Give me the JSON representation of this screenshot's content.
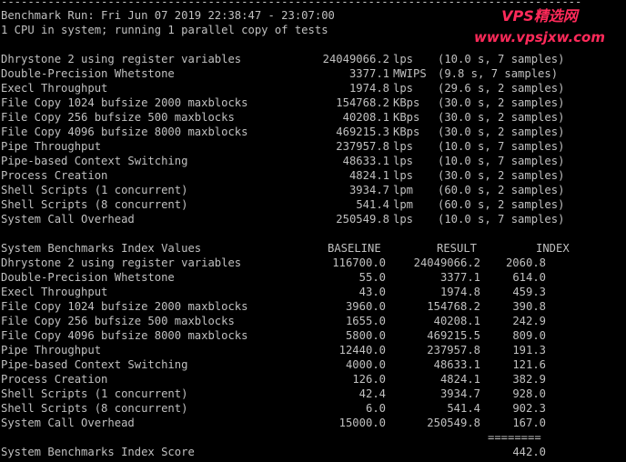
{
  "theme": {
    "background": "#000000",
    "text": "#c0c0c0",
    "watermark": "#ff2a5a"
  },
  "divider": "---------------------------------------------------------------------------------------",
  "header": {
    "run_line": "Benchmark Run: Fri Jun 07 2019 22:38:47 - 23:07:00",
    "cpu_line": "1 CPU in system; running 1 parallel copy of tests"
  },
  "watermark": {
    "title": "VPS精选网",
    "url": "www.vpsjxw.com"
  },
  "results": [
    {
      "name": "Dhrystone 2 using register variables",
      "value": "24049066.2",
      "unit": "lps",
      "detail": "(10.0 s, 7 samples)"
    },
    {
      "name": "Double-Precision Whetstone",
      "value": "3377.1",
      "unit": "MWIPS",
      "detail": "(9.8 s, 7 samples)"
    },
    {
      "name": "Execl Throughput",
      "value": "1974.8",
      "unit": "lps",
      "detail": "(29.6 s, 2 samples)"
    },
    {
      "name": "File Copy 1024 bufsize 2000 maxblocks",
      "value": "154768.2",
      "unit": "KBps",
      "detail": "(30.0 s, 2 samples)"
    },
    {
      "name": "File Copy 256 bufsize 500 maxblocks",
      "value": "40208.1",
      "unit": "KBps",
      "detail": "(30.0 s, 2 samples)"
    },
    {
      "name": "File Copy 4096 bufsize 8000 maxblocks",
      "value": "469215.3",
      "unit": "KBps",
      "detail": "(30.0 s, 2 samples)"
    },
    {
      "name": "Pipe Throughput",
      "value": "237957.8",
      "unit": "lps",
      "detail": "(10.0 s, 7 samples)"
    },
    {
      "name": "Pipe-based Context Switching",
      "value": "48633.1",
      "unit": "lps",
      "detail": "(10.0 s, 7 samples)"
    },
    {
      "name": "Process Creation",
      "value": "4824.1",
      "unit": "lps",
      "detail": "(30.0 s, 2 samples)"
    },
    {
      "name": "Shell Scripts (1 concurrent)",
      "value": "3934.7",
      "unit": "lpm",
      "detail": "(60.0 s, 2 samples)"
    },
    {
      "name": "Shell Scripts (8 concurrent)",
      "value": "541.4",
      "unit": "lpm",
      "detail": "(60.0 s, 2 samples)"
    },
    {
      "name": "System Call Overhead",
      "value": "250549.8",
      "unit": "lps",
      "detail": "(10.0 s, 7 samples)"
    }
  ],
  "index_table": {
    "title": "System Benchmarks Index Values",
    "headers": {
      "baseline": "BASELINE",
      "result": "RESULT",
      "index": "INDEX"
    },
    "rows": [
      {
        "name": "Dhrystone 2 using register variables",
        "baseline": "116700.0",
        "result": "24049066.2",
        "index": "2060.8"
      },
      {
        "name": "Double-Precision Whetstone",
        "baseline": "55.0",
        "result": "3377.1",
        "index": "614.0"
      },
      {
        "name": "Execl Throughput",
        "baseline": "43.0",
        "result": "1974.8",
        "index": "459.3"
      },
      {
        "name": "File Copy 1024 bufsize 2000 maxblocks",
        "baseline": "3960.0",
        "result": "154768.2",
        "index": "390.8"
      },
      {
        "name": "File Copy 256 bufsize 500 maxblocks",
        "baseline": "1655.0",
        "result": "40208.1",
        "index": "242.9"
      },
      {
        "name": "File Copy 4096 bufsize 8000 maxblocks",
        "baseline": "5800.0",
        "result": "469215.5",
        "index": "809.0"
      },
      {
        "name": "Pipe Throughput",
        "baseline": "12440.0",
        "result": "237957.8",
        "index": "191.3"
      },
      {
        "name": "Pipe-based Context Switching",
        "baseline": "4000.0",
        "result": "48633.1",
        "index": "121.6"
      },
      {
        "name": "Process Creation",
        "baseline": "126.0",
        "result": "4824.1",
        "index": "382.9"
      },
      {
        "name": "Shell Scripts (1 concurrent)",
        "baseline": "42.4",
        "result": "3934.7",
        "index": "928.0"
      },
      {
        "name": "Shell Scripts (8 concurrent)",
        "baseline": "6.0",
        "result": "541.4",
        "index": "902.3"
      },
      {
        "name": "System Call Overhead",
        "baseline": "15000.0",
        "result": "250549.8",
        "index": "167.0"
      }
    ],
    "separator": "========",
    "score_label": "System Benchmarks Index Score",
    "score": "442.0"
  }
}
